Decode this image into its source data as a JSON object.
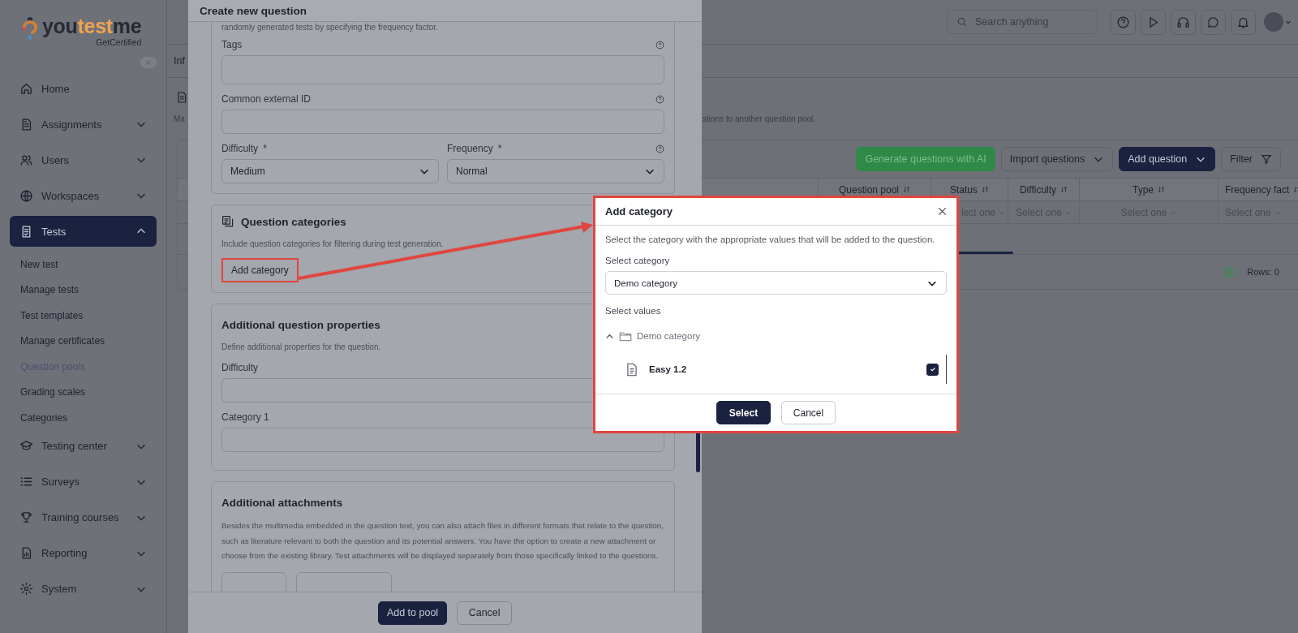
{
  "sidebar": {
    "logo": {
      "start": "you",
      "accent": "test",
      "end": "me",
      "tagline": "GetCertified"
    },
    "items": [
      {
        "label": "Home",
        "kind": "link",
        "selected": false
      },
      {
        "label": "Assignments",
        "kind": "group",
        "selected": false,
        "expanded": false
      },
      {
        "label": "Users",
        "kind": "group",
        "selected": false,
        "expanded": false
      },
      {
        "label": "Workspaces",
        "kind": "group",
        "selected": false,
        "expanded": false
      },
      {
        "label": "Tests",
        "kind": "group",
        "selected": true,
        "expanded": true,
        "children": [
          {
            "label": "New test",
            "selected": false
          },
          {
            "label": "Manage tests",
            "selected": false
          },
          {
            "label": "Test templates",
            "selected": false
          },
          {
            "label": "Manage certificates",
            "selected": false
          },
          {
            "label": "Question pools",
            "selected": true
          },
          {
            "label": "Grading scales",
            "selected": false
          },
          {
            "label": "Categories",
            "selected": false
          }
        ]
      },
      {
        "label": "Testing center",
        "kind": "group",
        "selected": false,
        "expanded": false
      },
      {
        "label": "Surveys",
        "kind": "group",
        "selected": false,
        "expanded": false
      },
      {
        "label": "Training courses",
        "kind": "group",
        "selected": false,
        "expanded": false
      },
      {
        "label": "Reporting",
        "kind": "group",
        "selected": false,
        "expanded": false
      },
      {
        "label": "System",
        "kind": "group",
        "selected": false,
        "expanded": false
      }
    ]
  },
  "topbar": {
    "search_placeholder": "Search anything"
  },
  "page": {
    "tab": "Inf",
    "description_start": "Ma",
    "description_end": "stions to another question pool."
  },
  "toolbar": [
    {
      "label": "Generate questions with AI",
      "kind": "ai"
    },
    {
      "label": "Import questions",
      "kind": "dropdown"
    },
    {
      "label": "Add question",
      "kind": "primary"
    },
    {
      "label": "Filter",
      "kind": "filter"
    }
  ],
  "table": {
    "columns": [
      {
        "label": "Question pool"
      },
      {
        "label": "Status",
        "filter": "lect one"
      },
      {
        "label": "Difficulty",
        "filter": "Select one"
      },
      {
        "label": "Type",
        "filter": "Select one"
      },
      {
        "label": "Frequency fact",
        "filter": "Select one"
      }
    ],
    "rows_label": "Rows: 0"
  },
  "question_modal": {
    "title": "Create new question",
    "intro": "randomly generated tests by specifying the frequency factor.",
    "fields": [
      {
        "label": "Tags",
        "help": true
      },
      {
        "label": "Common external ID",
        "help": true
      }
    ],
    "selects": [
      {
        "label": "Difficulty",
        "required_mark": "*",
        "value": "Medium",
        "help": false
      },
      {
        "label": "Frequency",
        "required_mark": "*",
        "value": "Normal",
        "help": true
      }
    ],
    "categories": {
      "title": "Question categories",
      "description": "Include question categories for filtering during test generation.",
      "button": "Add category"
    },
    "properties": {
      "title": "Additional question properties",
      "description": "Define additional properties for the question.",
      "fields": [
        {
          "label": "Difficulty"
        },
        {
          "label": "Category 1"
        }
      ]
    },
    "attachments": {
      "title": "Additional attachments",
      "description": "Besides the multimedia embedded in the question text, you can also attach files in different formats that relate to the question, such as literature relevant to both the question and its potential answers. You have the option to create a new attachment or choose from the existing library. Test attachments will be displayed separately from those specifically linked to the questions."
    },
    "buttons": [
      {
        "label": "Add to pool",
        "kind": "primary"
      },
      {
        "label": "Cancel",
        "kind": "secondary"
      }
    ]
  },
  "add_category_dialog": {
    "title": "Add category",
    "description": "Select the category with the appropriate values that will be added to the question.",
    "select_label": "Select category",
    "select_value": "Demo category",
    "values_label": "Select values",
    "tree": [
      {
        "label": "Demo category",
        "expanded": true,
        "children": [
          {
            "label": "Easy 1.2",
            "checked": true
          }
        ]
      }
    ],
    "buttons": [
      {
        "label": "Select",
        "kind": "primary"
      },
      {
        "label": "Cancel",
        "kind": "secondary"
      }
    ]
  }
}
